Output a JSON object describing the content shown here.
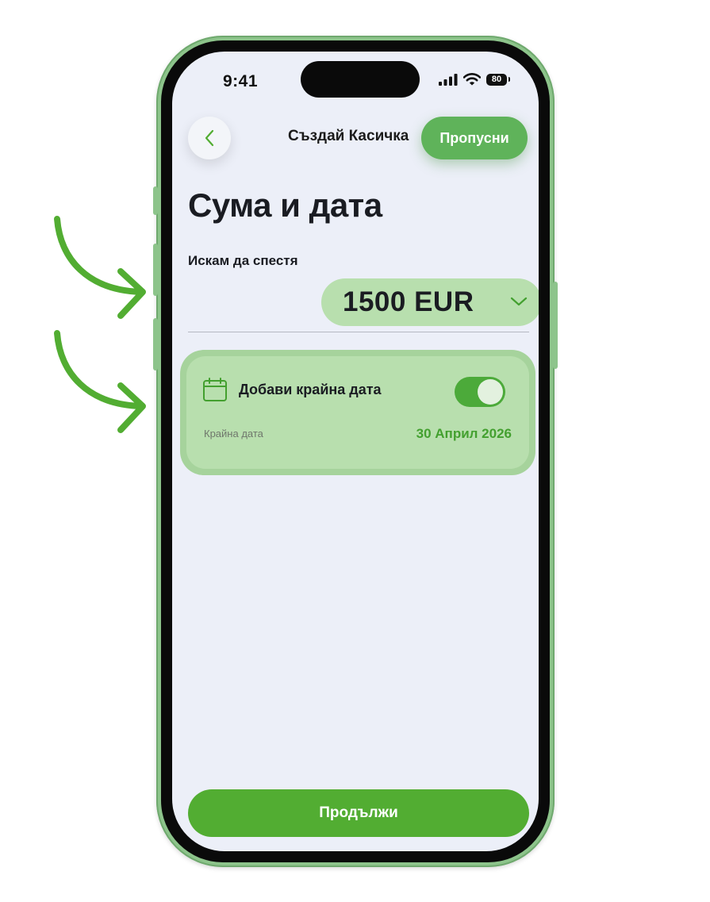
{
  "status_bar": {
    "time": "9:41",
    "battery": "80"
  },
  "header": {
    "back_icon": "chevron-left-icon",
    "title": "Създай Касичка",
    "skip_label": "Пропусни"
  },
  "page": {
    "title": "Сума и дата"
  },
  "amount": {
    "label": "Искам да спестя",
    "value": "1500 EUR",
    "chevron_icon": "chevron-down-icon"
  },
  "deadline": {
    "icon": "calendar-icon",
    "title": "Добави крайна дата",
    "toggle_on": true,
    "end_label": "Крайна дата",
    "end_value": "30 Април 2026"
  },
  "footer": {
    "continue_label": "Продължи"
  },
  "colors": {
    "accent": "#52ad32",
    "accent_light": "#b8dfae",
    "frame": "#8dc48b",
    "arrow": "#52ad32",
    "background": "#eceff8"
  }
}
